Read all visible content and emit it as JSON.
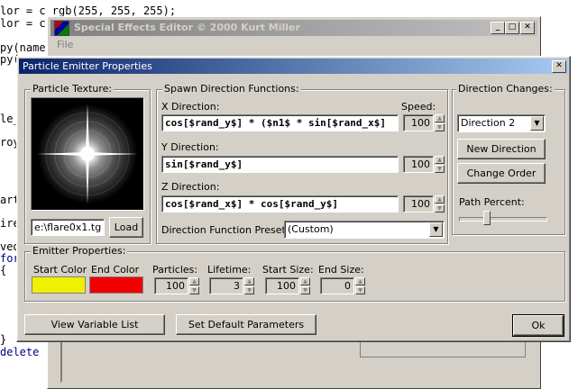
{
  "background_code": {
    "lines": [
      {
        "text": "lor = c rgb(255, 255, 255);",
        "color": "#000000"
      },
      {
        "text": "lor = c",
        "color": "#000000"
      },
      {
        "text": "py(name",
        "color": "#000000"
      },
      {
        "text": "py(",
        "color": "#000000"
      },
      {
        "text": "le_",
        "color": "#000000"
      },
      {
        "text": "roy",
        "color": "#000000"
      },
      {
        "text": "art",
        "color": "#000000"
      },
      {
        "text": "ire",
        "color": "#000000"
      },
      {
        "text": "ved",
        "color": "#000000"
      },
      {
        "text": "for",
        "color": "#00008b"
      },
      {
        "text": "{",
        "color": "#000000"
      },
      {
        "text": "}",
        "color": "#000000"
      },
      {
        "text": "delete",
        "color": "#00008b"
      }
    ]
  },
  "background_window": {
    "title": "Special Effects Editor © 2000 Kurt Miller",
    "menu_file": "File",
    "controls": {
      "minimize": "_",
      "maximize": "□",
      "close": "✕"
    }
  },
  "dialog": {
    "title": "Particle Emitter Properties",
    "close": "✕",
    "texture": {
      "legend": "Particle Texture:",
      "filename": "e:\\flare0x1.tga",
      "load_button": "Load"
    },
    "spawn": {
      "legend": "Spawn Direction Functions:",
      "speed_label": "Speed:",
      "x_label": "X Direction:",
      "x_value": "cos[$rand_y$] * ($n1$ * sin[$rand_x$]",
      "x_speed": "100",
      "y_label": "Y Direction:",
      "y_value": "sin[$rand_y$]",
      "y_speed": "100",
      "z_label": "Z Direction:",
      "z_value": "cos[$rand_x$] * cos[$rand_y$]",
      "z_speed": "100",
      "presets_label": "Direction Function Presets:",
      "presets_value": "(Custom)"
    },
    "direction_changes": {
      "legend": "Direction Changes:",
      "selected": "Direction 2",
      "new_button": "New Direction",
      "change_order_button": "Change Order",
      "path_percent_label": "Path Percent:",
      "path_percent_value": 0.3
    },
    "emitter": {
      "legend": "Emitter Properties:",
      "start_color_label": "Start Color",
      "end_color_label": "End Color",
      "start_color": "#f0f000",
      "end_color": "#f00000",
      "particles_label": "Particles:",
      "particles_value": "100",
      "lifetime_label": "Lifetime:",
      "lifetime_value": "3",
      "start_size_label": "Start Size:",
      "start_size_value": "100",
      "end_size_label": "End Size:",
      "end_size_value": "0"
    },
    "buttons": {
      "view_variables": "View Variable List",
      "set_defaults": "Set Default Parameters",
      "ok": "Ok"
    }
  }
}
